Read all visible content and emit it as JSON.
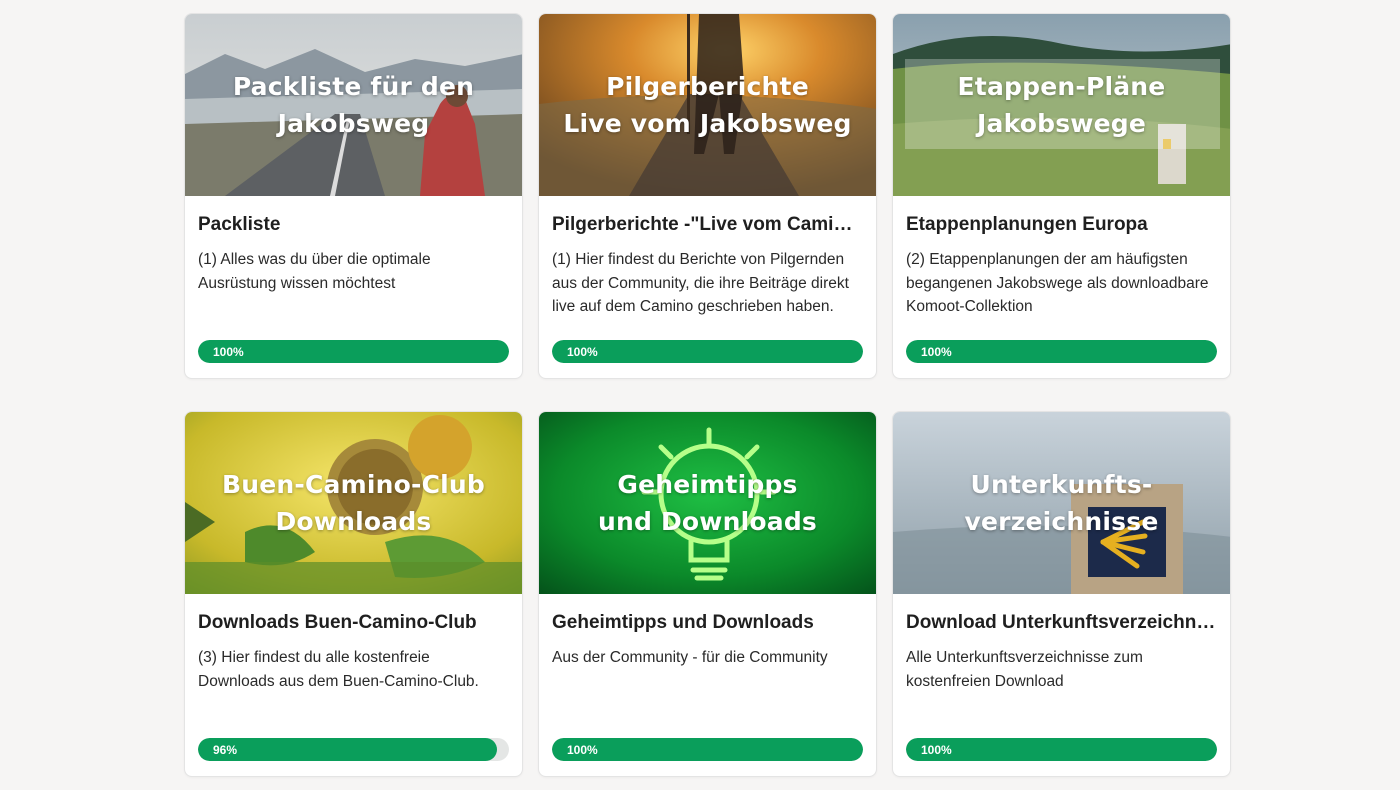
{
  "colors": {
    "progress_fill": "#0a9e5b",
    "progress_track": "#e4e6e5",
    "background": "#f6f5f4"
  },
  "cards": [
    {
      "image_lines": [
        "Packliste für den",
        "Jakobsweg"
      ],
      "title": "Packliste",
      "description": "(1) Alles was du über die optimale Ausrüstung wissen möchtest",
      "progress": 100,
      "progress_label": "100%"
    },
    {
      "image_lines": [
        "Pilgerberichte",
        "Live vom Jakobsweg"
      ],
      "title": "Pilgerberichte -\"Live vom Camino\"",
      "description": "(1) Hier findest du Berichte von Pilgernden aus der Community, die ihre Beiträge direkt live auf dem Camino geschrieben haben.",
      "progress": 100,
      "progress_label": "100%"
    },
    {
      "image_lines": [
        "Etappen-Pläne",
        "Jakobswege"
      ],
      "title": "Etappenplanungen Europa",
      "description": "(2) Etappenplanungen der am häufigsten begangenen Jakobswege als downloadbare Komoot-Collektion",
      "progress": 100,
      "progress_label": "100%"
    },
    {
      "image_lines": [
        "Buen-Camino-Club",
        "Downloads"
      ],
      "title": "Downloads Buen-Camino-Club",
      "description": "(3) Hier findest du alle kostenfreie Downloads aus dem Buen-Camino-Club.",
      "progress": 96,
      "progress_label": "96%"
    },
    {
      "image_lines": [
        "Geheimtipps",
        "und Downloads"
      ],
      "title": "Geheimtipps und Downloads",
      "description": "Aus der Community - für die Community",
      "progress": 100,
      "progress_label": "100%"
    },
    {
      "image_lines": [
        "Unterkunfts-",
        "verzeichnisse"
      ],
      "title": "Download Unterkunftsverzeichnisse",
      "description": "Alle Unterkunftsverzeichnisse zum kostenfreien Download",
      "progress": 100,
      "progress_label": "100%"
    }
  ]
}
